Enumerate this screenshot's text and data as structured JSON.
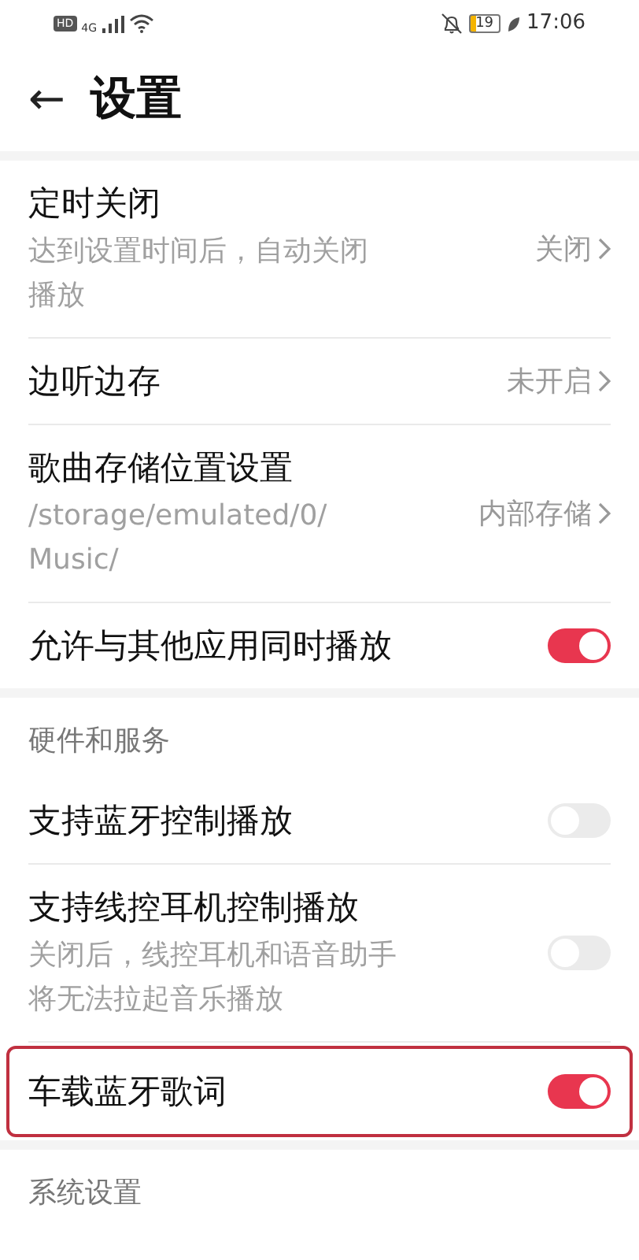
{
  "status_bar": {
    "hd": "HD",
    "network": "4G",
    "battery": "19",
    "time": "17:06"
  },
  "header": {
    "back": "←",
    "title": "设置"
  },
  "sections": [
    {
      "rows": [
        {
          "kind": "link",
          "title": "定时关闭",
          "subtitle": "达到设置时间后，自动关闭播放",
          "value": "关闭"
        },
        {
          "kind": "link",
          "title": "边听边存",
          "value": "未开启"
        },
        {
          "kind": "link",
          "title": "歌曲存储位置设置",
          "subtitle": "/storage/emulated/0/Music/",
          "value": "内部存储"
        },
        {
          "kind": "switch",
          "title": "允许与其他应用同时播放",
          "on": true,
          "highlighted": false
        }
      ]
    },
    {
      "heading": "硬件和服务",
      "rows": [
        {
          "kind": "switch",
          "title": "支持蓝牙控制播放",
          "on": false,
          "highlighted": false
        },
        {
          "kind": "switch",
          "title": "支持线控耳机控制播放",
          "subtitle": "关闭后，线控耳机和语音助手将无法拉起音乐播放",
          "on": false,
          "highlighted": false
        },
        {
          "kind": "switch",
          "title": "车载蓝牙歌词",
          "on": true,
          "highlighted": true
        }
      ]
    },
    {
      "heading": "系统设置"
    }
  ]
}
